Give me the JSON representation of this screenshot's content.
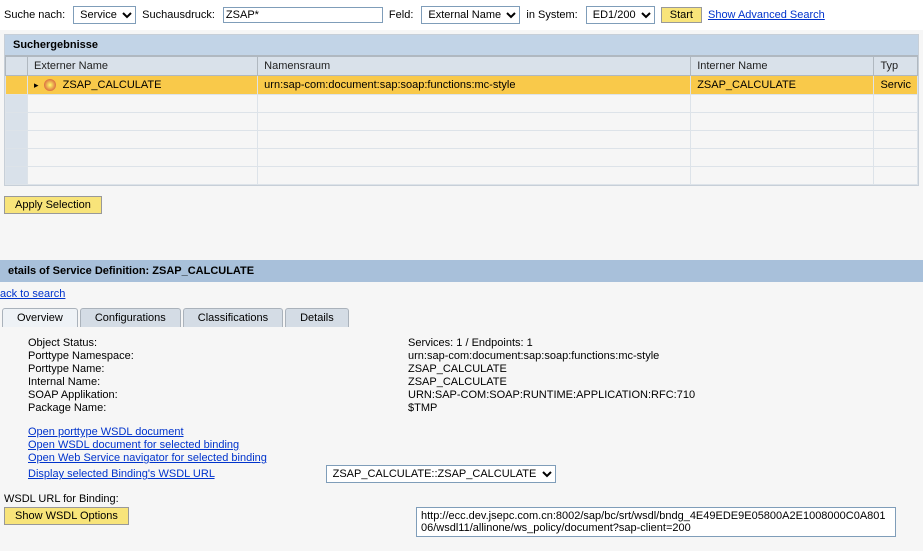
{
  "search": {
    "label_for": "Suche nach:",
    "dropdown_for": "Service",
    "label_expr": "Suchausdruck:",
    "expr_value": "ZSAP*",
    "label_field": "Feld:",
    "dropdown_field": "External Name",
    "label_in_system": "in System:",
    "dropdown_system": "ED1/200",
    "btn_start": "Start",
    "link_advanced": "Show Advanced Search"
  },
  "results": {
    "title": "Suchergebnisse",
    "cols": {
      "ext": "Externer Name",
      "ns": "Namensraum",
      "int": "Interner Name",
      "typ": "Typ"
    },
    "row": {
      "ext": "ZSAP_CALCULATE",
      "ns": "urn:sap-com:document:sap:soap:functions:mc-style",
      "int": "ZSAP_CALCULATE",
      "typ": "Servic"
    },
    "btn_apply": "Apply Selection"
  },
  "details": {
    "title": "etails of Service Definition: ZSAP_CALCULATE",
    "back": "ack to search",
    "tabs": {
      "t1": "Overview",
      "t2": "Configurations",
      "t3": "Classifications",
      "t4": "Details"
    },
    "fields": {
      "obj_status_k": "Object Status:",
      "obj_status_v": "Services: 1 / Endpoints: 1",
      "ptns_k": "Porttype Namespace:",
      "ptns_v": "urn:sap-com:document:sap:soap:functions:mc-style",
      "ptn_k": "Porttype Name:",
      "ptn_v": "ZSAP_CALCULATE",
      "in_k": "Internal Name:",
      "in_v": "ZSAP_CALCULATE",
      "soap_k": "SOAP Applikation:",
      "soap_v": "URN:SAP-COM:SOAP:RUNTIME:APPLICATION:RFC:710",
      "pkg_k": "Package Name:",
      "pkg_v": "$TMP"
    },
    "links": {
      "l1": "Open porttype WSDL document",
      "l2": "Open WSDL document for selected binding",
      "l3": "Open Web Service navigator for selected binding",
      "l4": "Display selected Binding's WSDL URL"
    },
    "binding_select": "ZSAP_CALCULATE::ZSAP_CALCULATE",
    "wsdl_label": "WSDL URL for Binding:",
    "btn_wsdl": "Show WSDL Options",
    "wsdl_url": "http://ecc.dev.jsepc.com.cn:8002/sap/bc/srt/wsdl/bndg_4E49EDE9E05800A2E1008000C0A80106/wsdl11/allinone/ws_policy/document?sap-client=200"
  }
}
